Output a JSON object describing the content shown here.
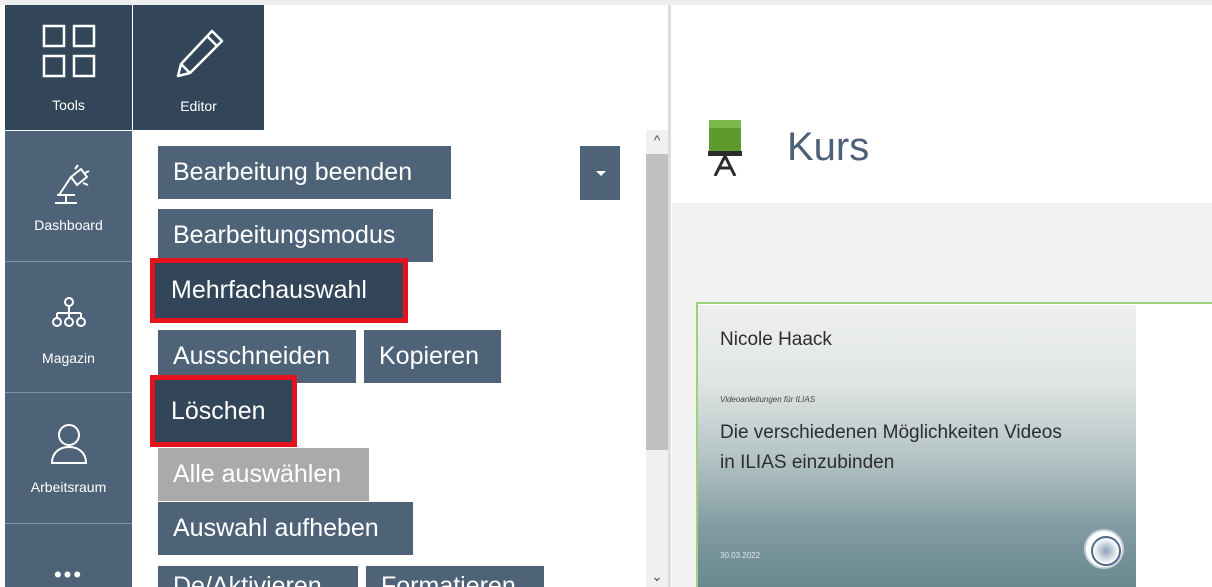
{
  "rail": {
    "tools_label": "Tools",
    "dashboard_label": "Dashboard",
    "magazin_label": "Magazin",
    "arbeitsraum_label": "Arbeitsraum",
    "more_label": "•••"
  },
  "editor_tab": {
    "label": "Editor"
  },
  "slate": {
    "buttons": {
      "bearbeitung_beenden": "Bearbeitung beenden",
      "bearbeitungsmodus": "Bearbeitungsmodus",
      "mehrfachauswahl": "Mehrfachauswahl",
      "ausschneiden": "Ausschneiden",
      "kopieren": "Kopieren",
      "loeschen": "Löschen",
      "alle_auswaehlen": "Alle auswählen",
      "auswahl_aufheben": "Auswahl aufheben",
      "de_aktivieren": "De/Aktivieren",
      "formatieren": "Formatieren"
    },
    "scroll_up": "^",
    "scroll_down": "⌄"
  },
  "main": {
    "title": "Kurs",
    "video": {
      "author": "Nicole Haack",
      "series": "Videoanleitungen für ILIAS",
      "title": "Die verschiedenen Möglichkeiten Videos in ILIAS einzubinden",
      "date": "30.03.2022"
    }
  },
  "colors": {
    "rail": "#4e6278",
    "rail_active": "#324559",
    "highlight": "#e5131d",
    "title": "#4d6176"
  }
}
